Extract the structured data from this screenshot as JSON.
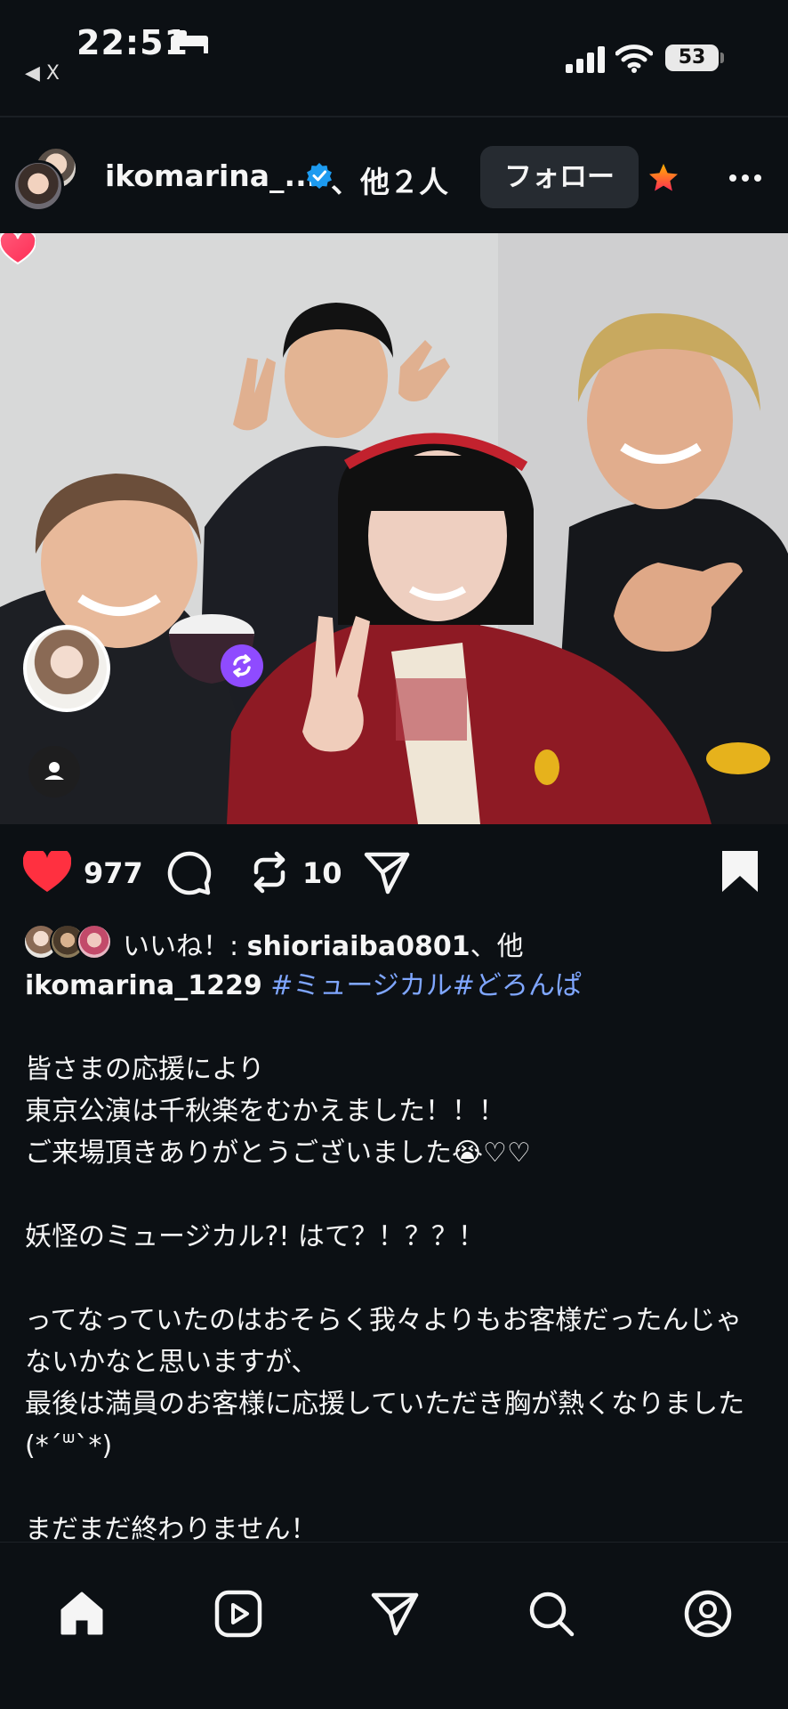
{
  "status_bar": {
    "time": "22:51",
    "back_app": "◀ X",
    "battery": "53"
  },
  "header": {
    "username": "ikomarina_...",
    "others": "、他２人",
    "follow_label": "フォロー",
    "verified_color": "#1d9bf0",
    "star_color": "#ff6a00"
  },
  "actions": {
    "likes": "977",
    "reposts": "10",
    "liked_color": "#ff3040"
  },
  "likes_line": {
    "prefix": "いいね！: ",
    "user": "shioriaiba0801",
    "suffix": "、他"
  },
  "caption": {
    "username": "ikomarina_1229",
    "hashtags": "#ミュージカル#どろんぱ",
    "body": "皆さまの応援により\n東京公演は千秋楽をむかえました！！！\nご来場頂きありがとうございました😭♡♡\n\n妖怪のミュージカル?! はて？！？？！\n\nってなっていたのはおそらく我々よりもお客様だったんじゃないかなと思いますが、\n最後は満員のお客様に応援していただき胸が熱くなりました (*´ᐜ`*)\n\nまだまだ終わりません！"
  },
  "nav": {
    "items": [
      "home-icon",
      "reels-icon",
      "direct-icon",
      "search-icon",
      "profile-icon"
    ]
  }
}
